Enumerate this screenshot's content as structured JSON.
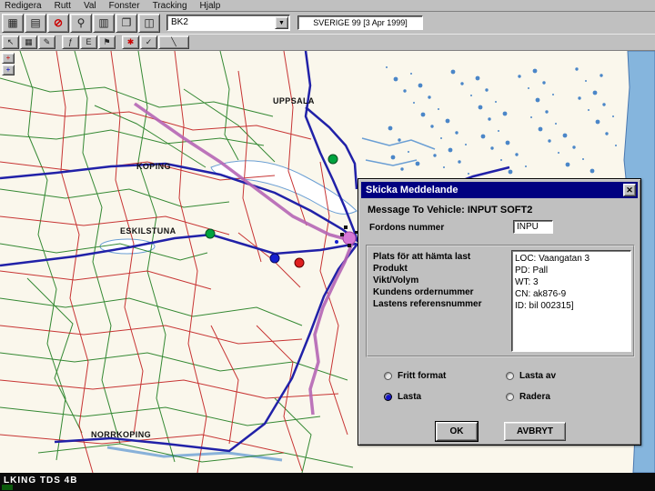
{
  "window": {
    "menu": {
      "items": [
        {
          "label": "Redigera"
        },
        {
          "label": "Rutt"
        },
        {
          "label": "Val"
        },
        {
          "label": "Fonster"
        },
        {
          "label": "Tracking"
        },
        {
          "label": "Hjalp"
        }
      ]
    },
    "toolbar": {
      "icons1": [
        {
          "name": "table-icon",
          "glyph": "▦"
        },
        {
          "name": "chart-icon",
          "glyph": "▤"
        },
        {
          "name": "stop-icon",
          "glyph": "⊘"
        },
        {
          "name": "zoom-icon",
          "glyph": "⚲"
        },
        {
          "name": "print-icon",
          "glyph": "▥"
        },
        {
          "name": "copy-pages-icon",
          "glyph": "❐"
        },
        {
          "name": "layers-icon",
          "glyph": "◫"
        }
      ],
      "dropdown_glyph": "▼",
      "vehicle_select": "BK2",
      "map_title": "SVERIGE 99 [3 Apr 1999]",
      "icons2": [
        {
          "name": "pointer-icon",
          "glyph": "↖"
        },
        {
          "name": "grid-icon",
          "glyph": "▦"
        },
        {
          "name": "pencil-icon",
          "glyph": "✎"
        },
        {
          "name": "function-icon",
          "glyph": "ƒ"
        },
        {
          "name": "label-icon",
          "glyph": "E"
        },
        {
          "name": "flag-icon",
          "glyph": "⚑"
        },
        {
          "name": "star-icon",
          "glyph": "✱"
        },
        {
          "name": "check-icon",
          "glyph": "✓"
        },
        {
          "name": "slash-icon",
          "glyph": "╲"
        }
      ]
    },
    "statusbar": {
      "text": "LKING TDS 4B"
    }
  },
  "map": {
    "labels": [
      {
        "name": "UPPSALA"
      },
      {
        "name": "KOPING"
      },
      {
        "name": "ESKILSTUNA"
      },
      {
        "name": "NORRKOPING"
      }
    ],
    "tools": [
      {
        "name": "zoom-in-tool",
        "glyph": "+"
      },
      {
        "name": "zoom-out-tool",
        "glyph": "+"
      }
    ],
    "colors": {
      "road_major": "#2121a8",
      "road_red": "#c22020",
      "road_green": "#1f7d1f",
      "route": "#b565b5",
      "sea": "#85b5dd",
      "marker_green": "#00a33e",
      "marker_blue": "#1520cf",
      "marker_red": "#df1f1f"
    }
  },
  "dialog": {
    "title": "Skicka Meddelande",
    "close_glyph": "✕",
    "message": "Message To Vehicle: INPUT SOFT2",
    "vehicle_label": "Fordons nummer",
    "vehicle_value": "INPU",
    "fields": [
      {
        "label": "Plats för att hämta last",
        "value": "LOC: Vaangatan 3"
      },
      {
        "label": "Produkt",
        "value": "PD: Pall"
      },
      {
        "label": "Vikt/Volym",
        "value": "WT: 3"
      },
      {
        "label": "Kundens ordernummer",
        "value": "CN: ak876-9"
      },
      {
        "label": "Lastens referensnummer",
        "value": "ID: bil 002315]"
      }
    ],
    "radios": [
      {
        "label": "Fritt format",
        "selected": false
      },
      {
        "label": "Lasta av",
        "selected": false
      },
      {
        "label": "Lasta",
        "selected": true
      },
      {
        "label": "Radera",
        "selected": false
      }
    ],
    "ok_label": "OK",
    "cancel_label": "AVBRYT"
  }
}
